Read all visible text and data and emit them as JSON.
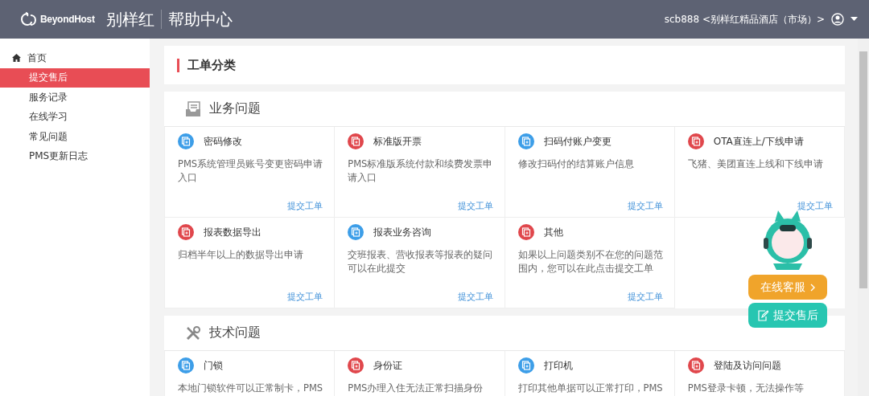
{
  "header": {
    "logo_text": "BeyondHost",
    "brand": "别样红",
    "title": "帮助中心",
    "user": "scb888 <别样红精品酒店（市场）>"
  },
  "sidebar": {
    "items": [
      {
        "label": "首页",
        "selected": false,
        "kind": "home"
      },
      {
        "label": "提交售后",
        "selected": true,
        "kind": "sub"
      },
      {
        "label": "服务记录",
        "selected": false,
        "kind": "sub"
      },
      {
        "label": "在线学习",
        "selected": false,
        "kind": "sub"
      },
      {
        "label": "常见问题",
        "selected": false,
        "kind": "sub"
      },
      {
        "label": "PMS更新日志",
        "selected": false,
        "kind": "sub"
      }
    ]
  },
  "page_title": "工单分类",
  "sections": [
    {
      "title": "业务问题",
      "kind": "business",
      "cards": [
        {
          "title": "密码修改",
          "color": "#3d9ee8",
          "description": "PMS系统管理员账号变更密码申请入口",
          "link": "提交工单"
        },
        {
          "title": "标准版开票",
          "color": "#e0474c",
          "description": "PMS标准版系统付款和续费发票申请入口",
          "link": "提交工单"
        },
        {
          "title": "扫码付账户变更",
          "color": "#3d9ee8",
          "description": "修改扫码付的结算账户信息",
          "link": "提交工单"
        },
        {
          "title": "OTA直连上/下线申请",
          "color": "#e0474c",
          "description": "飞猪、美团直连上线和下线申请",
          "link": "提交工单"
        },
        {
          "title": "报表数据导出",
          "color": "#e0474c",
          "description": "归档半年以上的数据导出申请",
          "link": "提交工单"
        },
        {
          "title": "报表业务咨询",
          "color": "#3d9ee8",
          "description": "交班报表、营收报表等报表的疑问可以在此提交",
          "link": "提交工单"
        },
        {
          "title": "其他",
          "color": "#e0474c",
          "description": "如果以上问题类别不在您的问题范围内，您可以在此点击提交工单",
          "link": "提交工单"
        }
      ]
    },
    {
      "title": "技术问题",
      "kind": "tech",
      "cards": [
        {
          "title": "门锁",
          "color": "#3d9ee8",
          "description": "本地门锁软件可以正常制卡，PMS"
        },
        {
          "title": "身份证",
          "color": "#e0474c",
          "description": "PMS办理入住无法正常扫描身份"
        },
        {
          "title": "打印机",
          "color": "#3d9ee8",
          "description": "打印其他单据可以正常打印，PMS"
        },
        {
          "title": "登陆及访问问题",
          "color": "#e0474c",
          "description": "PMS登录卡顿，无法操作等"
        }
      ]
    }
  ],
  "float_buttons": [
    {
      "label": "在线客服",
      "kind": "chat"
    },
    {
      "label": "提交售后",
      "kind": "submit"
    }
  ]
}
